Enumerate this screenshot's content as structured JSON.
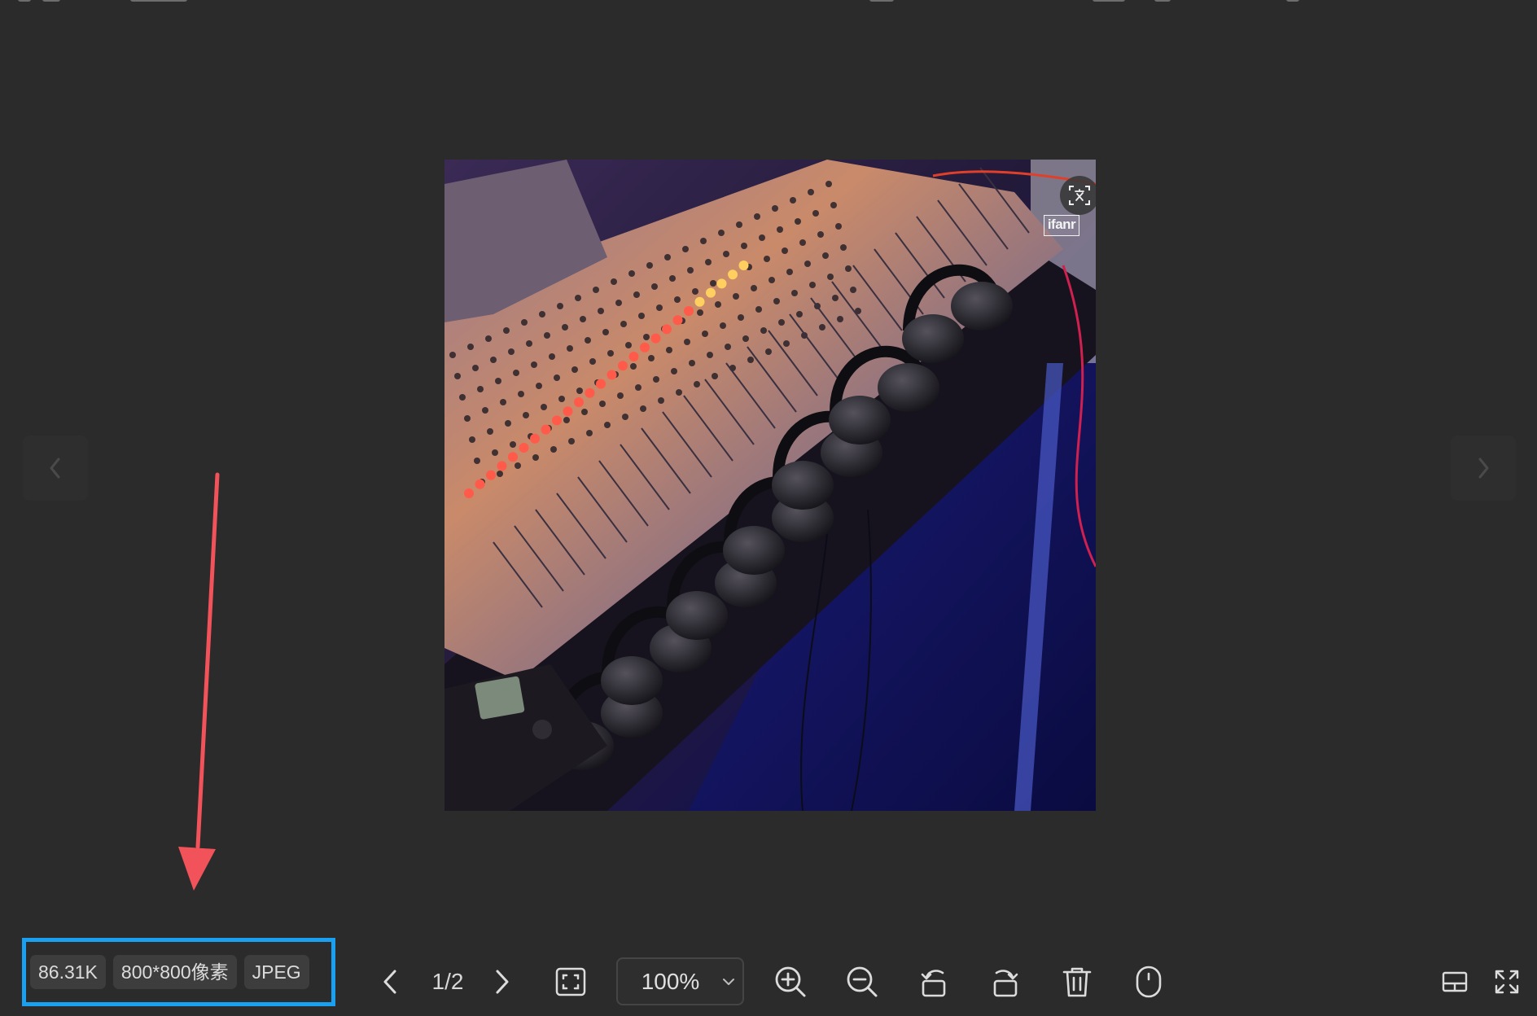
{
  "image_info": {
    "file_size": "86.31K",
    "dimensions": "800*800像素",
    "format": "JPEG"
  },
  "navigation": {
    "page_indicator": "1/2",
    "prev_label": "‹",
    "next_label": "›"
  },
  "zoom": {
    "value": "100%"
  },
  "photo": {
    "watermark_text": "ifanr",
    "ocr_icon": "translate-scan-icon",
    "subject": "audio-mixer-and-headphones"
  },
  "toolbar_icons": {
    "prev": "chevron-left-icon",
    "next": "chevron-right-icon",
    "fit": "fit-screen-icon",
    "zoom_in": "zoom-in-icon",
    "zoom_out": "zoom-out-icon",
    "rotate_left": "rotate-left-icon",
    "rotate_right": "rotate-right-icon",
    "delete": "trash-icon",
    "mouse": "mouse-icon",
    "filmstrip": "filmstrip-icon",
    "fullscreen": "fullscreen-icon"
  },
  "colors": {
    "background": "#2b2b2b",
    "highlight_box": "#1aa0f0",
    "annotation_arrow": "#f2525a",
    "chip_bg": "#3d3d3d",
    "icon": "#dcdcdc"
  }
}
